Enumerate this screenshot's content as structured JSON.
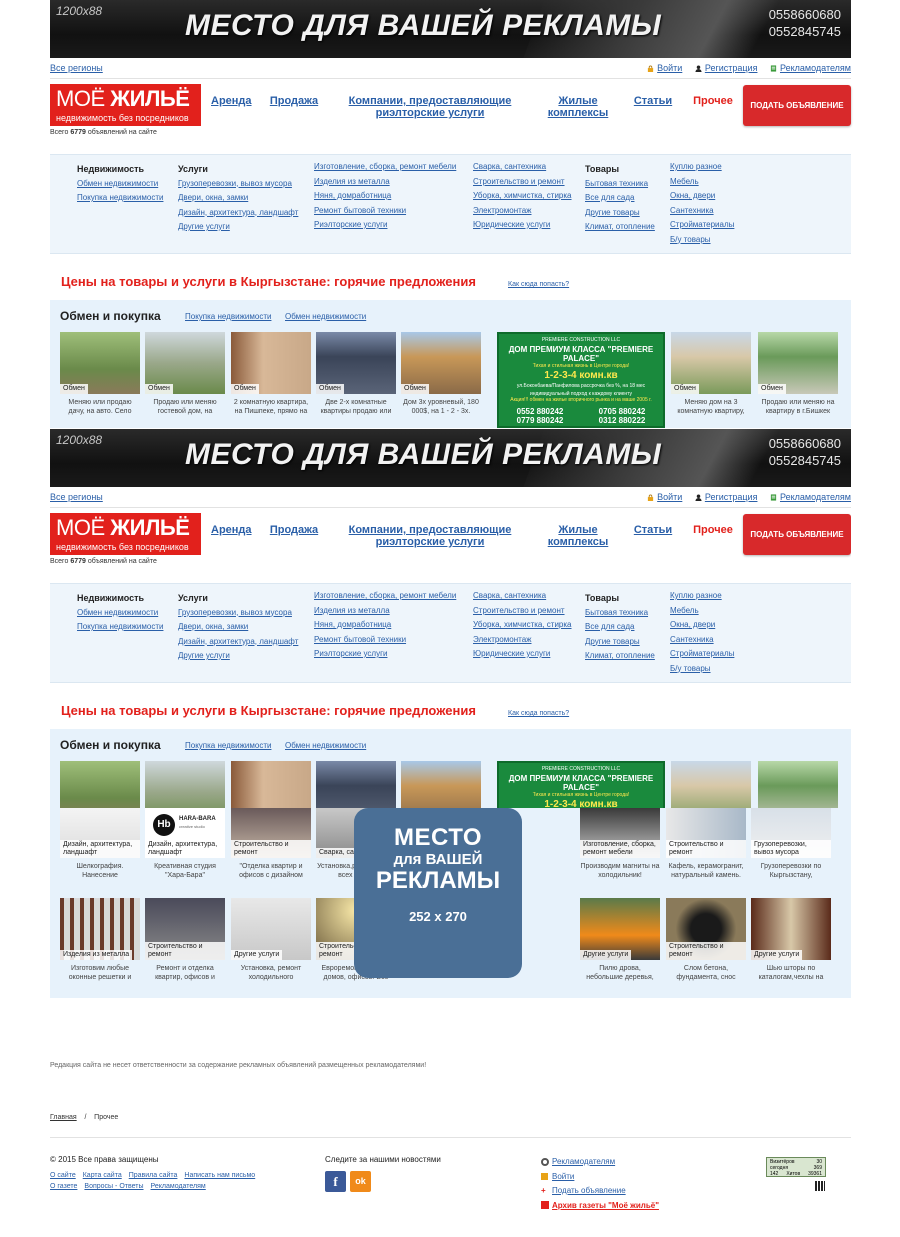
{
  "banner": {
    "size": "1200x88",
    "slogan": "МЕСТО ДЛЯ ВАШЕЙ РЕКЛАМЫ",
    "phone1": "0558660680",
    "phone2": "0552845745"
  },
  "top": {
    "regions": "Все регионы",
    "login": "Войти",
    "register": "Регистрация",
    "advertisers": "Рекламодателям"
  },
  "logo": {
    "title_a": "МОЁ ",
    "title_b": "ЖИЛЬЁ",
    "subtitle": "недвижимость без посредников"
  },
  "count": {
    "prefix": "Всего ",
    "value": "6779",
    "suffix": " объявлений на сайте"
  },
  "nav": {
    "rent": "Аренда",
    "sale": "Продажа",
    "companies": "Компании, предоставляющие риэлторские услуги",
    "complexes": "Жилые комплексы",
    "articles": "Статьи",
    "other": "Прочее",
    "post": "ПОДАТЬ ОБЪЯВЛЕНИЕ"
  },
  "cats": {
    "realty": {
      "title": "Недвижимость",
      "items": [
        "Обмен недвижимости",
        "Покупка недвижимости"
      ]
    },
    "services": {
      "title": "Услуги",
      "items": [
        "Грузоперевозки, вывоз мусора",
        "Двери, окна, замки",
        "Дизайн, архитектура, ландшафт",
        "Другие услуги"
      ]
    },
    "services2": {
      "items": [
        "Изготовление, сборка, ремонт мебели",
        "Изделия из металла",
        "Няня, домработница",
        "Ремонт бытовой техники",
        "Риэлторские услуги"
      ]
    },
    "services3": {
      "items": [
        "Сварка, сантехника",
        "Строительство и ремонт",
        "Уборка, химчистка, стирка",
        "Электромонтаж",
        "Юридические услуги"
      ]
    },
    "goods": {
      "title": "Товары",
      "items": [
        "Бытовая техника",
        "Все для сада",
        "Другие товары",
        "Климат, отопление"
      ]
    },
    "goods2": {
      "items": [
        "Куплю разное",
        "Мебель",
        "Окна, двери",
        "Сантехника",
        "Стройматериалы",
        "Б/у товары"
      ]
    }
  },
  "hot": {
    "title": "Цены на товары и услуги в Кыргызстане: горячие предложения",
    "how": "Как сюда попасть?"
  },
  "offers": {
    "title": "Обмен и покупка",
    "link1": "Покупка недвижимости",
    "link2": "Обмен недвижимости",
    "row1": [
      {
        "tag": "Обмен",
        "cap": "Меняю или продаю дачу, на авто. Село"
      },
      {
        "tag": "Обмен",
        "cap": "Продаю или меняю гостевой дом, на"
      },
      {
        "tag": "Обмен",
        "cap": "2 комнатную квартира, на Пишпеке, прямо на"
      },
      {
        "tag": "Обмен",
        "cap": "Две 2-х комнатные квартиры продаю или"
      },
      {
        "tag": "Обмен",
        "cap": "Дом 3х уровневый, 180 000$, на 1 - 2 - 3х."
      },
      {
        "tag": "Обмен",
        "cap": "Меняю дом на 3 комнатную квартиру,"
      },
      {
        "tag": "Обмен",
        "cap": "Продаю или меняю на квартиру в г.Бишкек"
      }
    ],
    "premium": {
      "company": "PREMIERE CONSTRUCTION LLC",
      "head": "ДОМ ПРЕМИУМ КЛАССА \"PREMIERE PALACE\"",
      "sub": "Тихая и стильная жизнь в Центре города!",
      "rooms": "1-2-3-4 комн.кв",
      "addr": "ул.Боконбаева/Панфилова  рассрочка без %, на 18 мес",
      "note": "индивидуальный подход к каждому клиенту",
      "promo": "Акция!!! обмен на жилье вторичного рынка и на маше 2005 г.",
      "p1": "0552 880242",
      "p2": "0705 880242",
      "p3": "0779 880242",
      "p4": "0312 880222"
    }
  },
  "services_row1": [
    {
      "tag": "Дизайн, архитектура, ландшафт",
      "cap": "Шелкография. Нанесение"
    },
    {
      "tag": "Дизайн, архитектура, ландшафт",
      "cap": "Креативная студия \"Хара-Бара\""
    },
    {
      "tag": "Строительство и ремонт",
      "cap": "\"Отделка квартир и офисов с дизайном"
    },
    {
      "tag": "Сварка, сантехника",
      "cap": "Установка,ремонт проф всех видов"
    },
    {
      "tag": "Изготовление, сборка, ремонт мебели",
      "cap": "Производим магниты на холодильник!"
    },
    {
      "tag": "Строительство и ремонт",
      "cap": "Кафель, керамогранит, натуральный камень."
    },
    {
      "tag": "Грузоперевозки, вывоз мусора",
      "cap": "Грузоперевозки по Кыргызстану,"
    }
  ],
  "services_row2": [
    {
      "tag": "Изделия из металла",
      "cap": "Изготовим любые оконные решетки и"
    },
    {
      "tag": "Строительство и ремонт",
      "cap": "Ремонт и отделка квартир, офисов и"
    },
    {
      "tag": "Другие услуги",
      "cap": "Установка, ремонт холодильного"
    },
    {
      "tag": "Строительство и ремонт",
      "cap": "Евроремонт квартир, домов, офисов. Все"
    },
    {
      "tag": "Другие услуги",
      "cap": "Пилю дрова, небольшие деревья,"
    },
    {
      "tag": "Строительство и ремонт",
      "cap": "Слом бетона, фундамента, снос"
    },
    {
      "tag": "Другие услуги",
      "cap": "Шью шторы по каталогам,чехлы на"
    }
  ],
  "bigad": {
    "l1": "МЕСТО",
    "l2": "для ВАШЕЙ",
    "l3": "РЕКЛАМЫ",
    "l4": "252 x 270"
  },
  "harabara": {
    "logo": "Hb",
    "name": "HARA-BARA",
    "sub": "creative studio"
  },
  "footer": {
    "disclaimer": "Редакция сайта не несет ответственности за содержание рекламных объявлений размещенных рекламодателями!",
    "crumb_home": "Главная",
    "crumb_sep": "/",
    "crumb_current": "Прочее",
    "copyright": "© 2015 Все права защищены",
    "links1": [
      "О сайте",
      "Карта сайта",
      "Правила сайта",
      "Написать нам письмо"
    ],
    "links2": [
      "О газете",
      "Вопросы - Ответы",
      "Рекламодателям"
    ],
    "follow": "Следите за нашими новостями",
    "fb": "f",
    "ok": "ok",
    "right": [
      "Рекламодателям",
      "Войти",
      "Подать объявление",
      "Архив газеты \"Моё жильё\""
    ],
    "counter": {
      "a": "Визитёров",
      "av": "30",
      "b": "сегодня",
      "bv": "369",
      "c": "Хитов",
      "cv": "39361",
      "d": "142"
    }
  },
  "colors": {
    "brand_red": "#e2211c",
    "link_blue": "#2a5fa8",
    "panel_bg": "#eef5fb",
    "ad_blue": "#4a6f96",
    "premium_green": "#1a8a3d"
  }
}
